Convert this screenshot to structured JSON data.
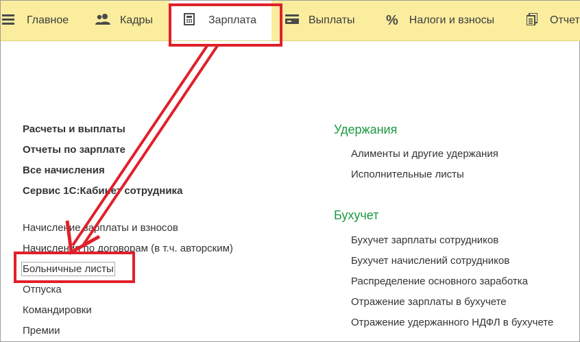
{
  "sections": [
    {
      "id": "main",
      "label": "Главное",
      "icon": "hamburger-icon"
    },
    {
      "id": "hr",
      "label": "Кадры",
      "icon": "people-icon"
    },
    {
      "id": "salary",
      "label": "Зарплата",
      "icon": "calculator-icon",
      "active": true
    },
    {
      "id": "payments",
      "label": "Выплаты",
      "icon": "card-icon"
    },
    {
      "id": "taxes",
      "label": "Налоги и взносы",
      "icon": "percent-icon"
    },
    {
      "id": "reports",
      "label": "Отчет",
      "icon": "report-icon"
    }
  ],
  "left_column": {
    "bold_items": [
      "Расчеты и выплаты",
      "Отчеты по зарплате",
      "Все начисления",
      "Сервис 1С:Кабинет сотрудника"
    ],
    "items": [
      "Начисление зарплаты и взносов",
      "Начисления по договорам (в т.ч. авторским)",
      "Больничные листы",
      "Отпуска",
      "Командировки",
      "Премии"
    ]
  },
  "right_column": {
    "groups": [
      {
        "title": "Удержания",
        "items": [
          "Алименты и другие удержания",
          "Исполнительные листы"
        ]
      },
      {
        "title": "Бухучет",
        "items": [
          "Бухучет зарплаты сотрудников",
          "Бухучет начислений сотрудников",
          "Распределение основного заработка",
          "Отражение зарплаты в бухучете",
          "Отражение удержанного НДФЛ в бухучете"
        ]
      }
    ]
  },
  "colors": {
    "topbar": "#fbed9e",
    "group_title": "#1a9a3f",
    "annotation": "#e0202a"
  }
}
